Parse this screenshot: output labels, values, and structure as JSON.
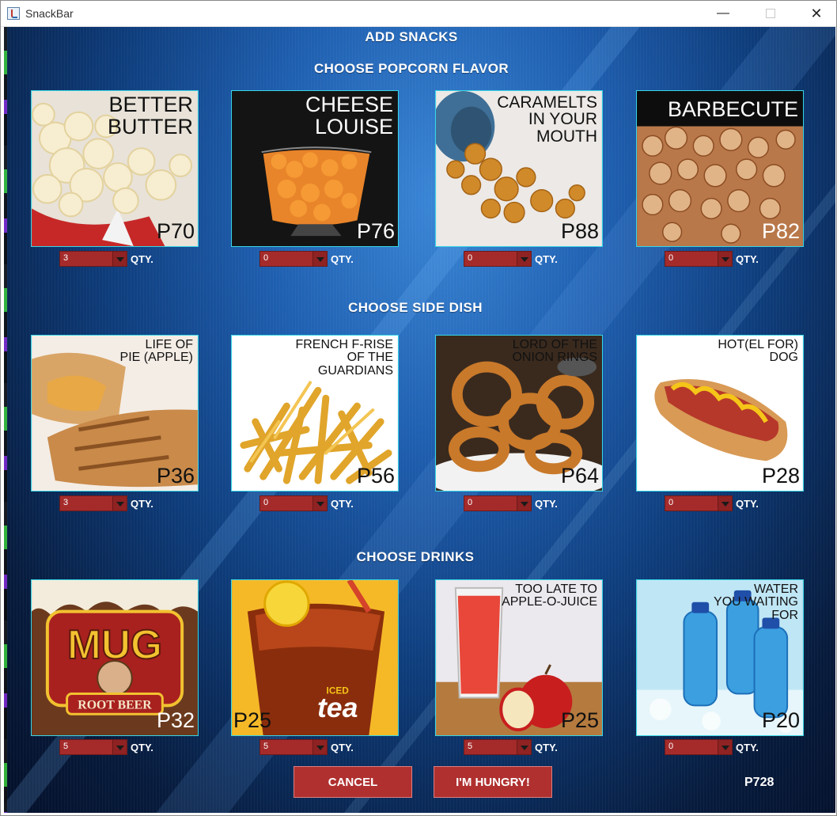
{
  "window": {
    "title": "SnackBar",
    "minimize": "—",
    "close": "✕"
  },
  "headings": {
    "add": "ADD SNACKS",
    "popcorn": "CHOOSE POPCORN FLAVOR",
    "side": "CHOOSE SIDE DISH",
    "drinks": "CHOOSE DRINKS"
  },
  "qty_label": "QTY.",
  "popcorn": [
    {
      "name": "BETTER\nBUTTER",
      "price": "P70",
      "qty": "3"
    },
    {
      "name": "CHEESE\nLOUISE",
      "price": "P76",
      "qty": "0"
    },
    {
      "name": "CARAMELTS\nIN YOUR\nMOUTH",
      "price": "P88",
      "qty": "0"
    },
    {
      "name": "BARBECUTE",
      "price": "P82",
      "qty": "0"
    }
  ],
  "side": [
    {
      "name": "LIFE OF\nPIE (APPLE)",
      "price": "P36",
      "qty": "3"
    },
    {
      "name": "FRENCH F-RISE\nOF THE\nGUARDIANS",
      "price": "P56",
      "qty": "0"
    },
    {
      "name": "LORD OF THE\nONION RINGS",
      "price": "P64",
      "qty": "0"
    },
    {
      "name": "HOT(EL FOR)\nDOG",
      "price": "P28",
      "qty": "0"
    }
  ],
  "drinks": [
    {
      "name": "",
      "price": "P32",
      "qty": "5",
      "logo_text": "MUG",
      "logo_sub": "ROOT BEER"
    },
    {
      "name": "",
      "price": "P25",
      "qty": "5",
      "logo_text": "tea",
      "logo_sub": "ICED"
    },
    {
      "name": "TOO LATE TO\nAPPLE-O-JUICE",
      "price": "P25",
      "qty": "5"
    },
    {
      "name": "WATER\nYOU WAITING\nFOR",
      "price": "P20",
      "qty": "0"
    }
  ],
  "buttons": {
    "cancel": "CANCEL",
    "hungry": "I'M HUNGRY!"
  },
  "total": "P728"
}
